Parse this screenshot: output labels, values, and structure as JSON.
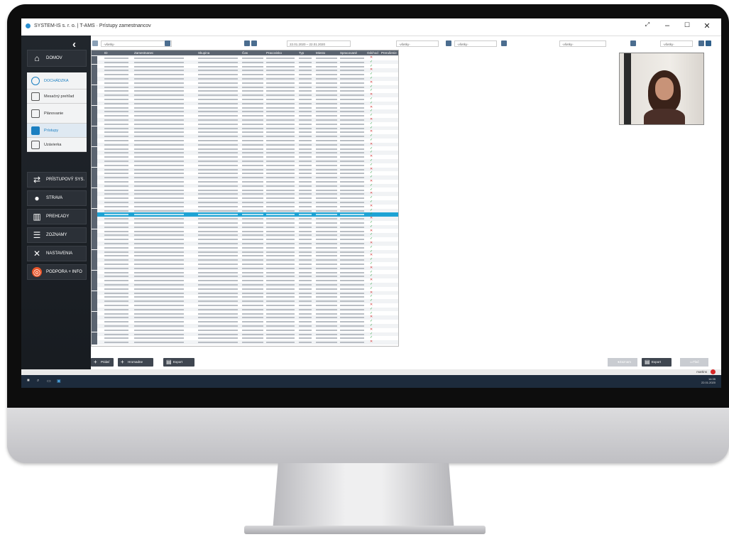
{
  "window": {
    "title": "SYSTEM-IS s. r. o. | T-AMS · Prístupy zamestnancov",
    "min": "–",
    "max": "☐",
    "close": "✕",
    "fullscreen": "⤢"
  },
  "sidebar": {
    "back": "‹",
    "items": [
      {
        "label": "DOMOV",
        "icon": "home-icon"
      },
      {
        "label": "DOCHÁDZKA",
        "icon": "clock-icon"
      },
      {
        "label": "Mesačný prehľad",
        "icon": "book-icon"
      },
      {
        "label": "Plánovanie",
        "icon": "calendar-icon"
      },
      {
        "label": "Prístupy",
        "icon": "flag-icon"
      },
      {
        "label": "Uzávierka",
        "icon": "stamp-icon"
      },
      {
        "label": "PRÍSTUPOVÝ SYS.",
        "icon": "handshake-icon"
      },
      {
        "label": "STRAVA",
        "icon": "food-icon"
      },
      {
        "label": "PREHĽADY",
        "icon": "chart-icon"
      },
      {
        "label": "ZOZNAMY",
        "icon": "list-icon"
      },
      {
        "label": "NASTAVENIA",
        "icon": "tools-icon"
      },
      {
        "label": "PODPORA + INFO",
        "icon": "lifebuoy-icon"
      }
    ]
  },
  "filters": {
    "person": "-všetky-",
    "date_range": "22.01.2020 – 22.01.2020",
    "f1": "-všetky-",
    "f2": "-všetky-",
    "f3": "-všetky-",
    "f4": "-všetky-"
  },
  "grid": {
    "columns": [
      "ID",
      "Zamestnanec",
      "Skupina",
      "Čas",
      "Pracovisko",
      "Typ",
      "Miesto",
      "Spracované",
      "Odchod",
      "Prerušenie"
    ]
  },
  "actions": {
    "add": "Pridať",
    "add_many": "Hromadne zapis",
    "export_left": "Export",
    "record": "Zaznam",
    "export": "Export",
    "print": "Tlač"
  },
  "taskbar": {
    "user": "martins",
    "time": "14:35",
    "date": "22.01.2020"
  }
}
